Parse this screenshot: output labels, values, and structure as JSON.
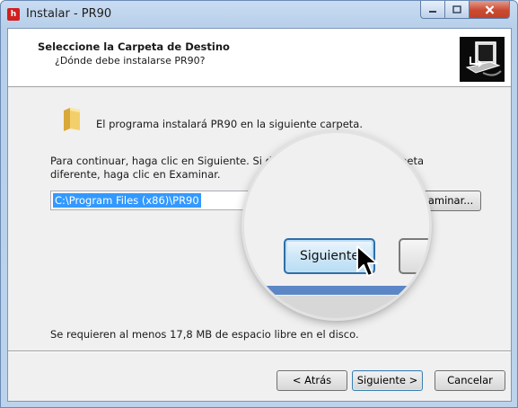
{
  "window": {
    "title": "Instalar - PR90",
    "app_icon_glyph": "h"
  },
  "header": {
    "title": "Seleccione la Carpeta de Destino",
    "subtitle": "¿Dónde debe instalarse PR90?",
    "image_icon": "computer-install-icon"
  },
  "body": {
    "folder_icon": "folder-icon",
    "intro": "El programa instalará PR90 en la siguiente carpeta.",
    "instructions": "Para continuar, haga clic en Siguiente. Si desea seleccionar una carpeta diferente, haga clic en Examinar.",
    "path_value": "C:\\Program Files (x86)\\PR90",
    "browse_label": "Examinar...",
    "space_text": "Se requieren al menos 17,8 MB de espacio libre en el disco."
  },
  "magnifier": {
    "button_label": "Siguiente",
    "cursor_icon": "mouse-pointer-icon"
  },
  "footer": {
    "back_label": "< Atrás",
    "next_label": "Siguiente >",
    "cancel_label": "Cancelar"
  },
  "colors": {
    "selection": "#3399ff",
    "close_button": "#c94a32",
    "window_frame": "#b7cfea"
  }
}
